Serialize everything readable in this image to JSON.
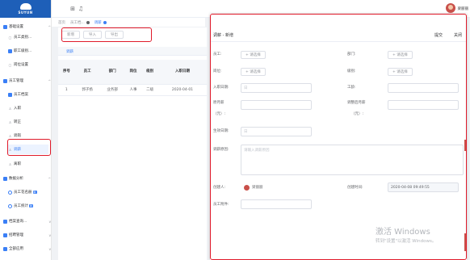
{
  "brand": {
    "name": "SUYUN"
  },
  "sidebar": {
    "items": [
      {
        "label": "基础设置",
        "icon": "folder-icon"
      },
      {
        "label": "员工类别...",
        "icon": "doc-icon"
      },
      {
        "label": "职工级别...",
        "icon": "doc-icon"
      },
      {
        "label": "岗位设置",
        "icon": "doc-icon"
      },
      {
        "label": "员工管理",
        "icon": "folder-icon"
      },
      {
        "label": "员工档案",
        "icon": "doc-icon"
      },
      {
        "label": "入职",
        "icon": "person-icon"
      },
      {
        "label": "转正",
        "icon": "person-icon"
      },
      {
        "label": "调岗",
        "icon": "person-icon"
      },
      {
        "label": "调薪",
        "icon": "person-icon"
      },
      {
        "label": "离职",
        "icon": "person-icon"
      },
      {
        "label": "数据分析",
        "icon": "folder-icon"
      },
      {
        "label": "员工花名册",
        "icon": "doc-icon",
        "tag": "新"
      },
      {
        "label": "员工统计",
        "icon": "doc-icon",
        "tag": "新"
      },
      {
        "label": "档案查询...",
        "icon": "people-icon"
      },
      {
        "label": "招聘管理",
        "icon": "people-icon"
      },
      {
        "label": "全部应用",
        "icon": "people-icon"
      }
    ]
  },
  "header": {
    "username": "梁丽丽"
  },
  "tabs": [
    {
      "label": "首页"
    },
    {
      "label": "员工档..."
    },
    {
      "label": "调薪"
    }
  ],
  "toolbar": {
    "add": "新增",
    "import": "导入",
    "export": "导出"
  },
  "subtab": {
    "label": "调薪"
  },
  "table": {
    "headers": [
      "序号",
      "员工",
      "部门",
      "岗位",
      "级别",
      "入职日期"
    ],
    "rows": [
      [
        "1",
        "郭子扬",
        "业务部",
        "人事",
        "二级",
        "2020-04-01"
      ]
    ]
  },
  "dialog": {
    "title": "调薪 - 新增",
    "actions": {
      "submit": "提交",
      "close": "关闭"
    },
    "labels": {
      "employee": "员工:",
      "department": "部门:",
      "position": "岗位:",
      "level": "级别:",
      "hire_date": "入职日期:",
      "work_no": "工龄:",
      "orig_salary": "原月薪",
      "adjusted_salary": "调整后月薪",
      "unit": "（元）:",
      "effective_date": "生效日期:",
      "reason": "调薪原因:",
      "creator": "创建人:",
      "created_time": "创建时间:",
      "attachment": "员工附件:"
    },
    "select_btn": "+ 请选择",
    "date_placeholder": "日",
    "reason_placeholder": "请输入调薪原因",
    "creator": "梁丽丽",
    "created_time": "2020-04-08 09:49:55"
  },
  "watermark": {
    "line1": "激活 Windows",
    "line2": "转到\"设置\"以激活 Windows。"
  }
}
